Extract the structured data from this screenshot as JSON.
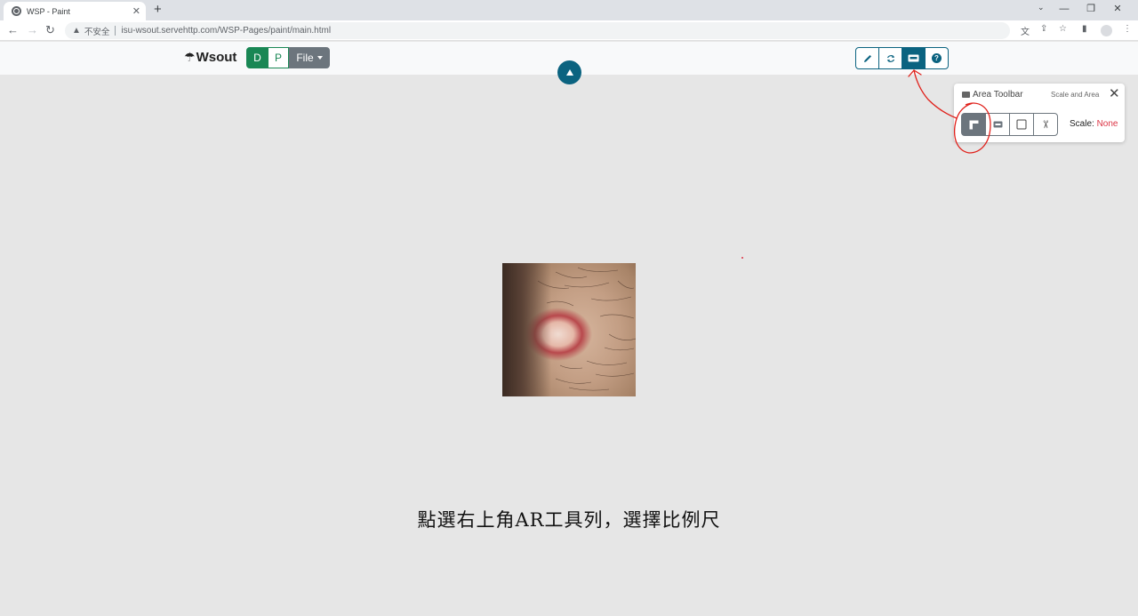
{
  "browser": {
    "tab_title": "WSP - Paint",
    "tab_close": "✕",
    "new_tab": "+",
    "security_label": "不安全",
    "url": "isu-wsout.servehttp.com/WSP-Pages/paint/main.html"
  },
  "navbar": {
    "brand_icon": "☂",
    "brand": "Wsout",
    "btn_d": "D",
    "btn_p": "P",
    "btn_file": "File",
    "tools": [
      "pencil-icon",
      "refresh-icon",
      "ar-icon",
      "help-icon"
    ],
    "help_glyph": "?"
  },
  "area_toolbar": {
    "title": "Area Toolbar",
    "subtitle": "Scale and Area",
    "close": "✕",
    "buttons": [
      "ruler-icon",
      "ar-icon",
      "square-icon",
      "scissors-icon"
    ],
    "scale_label": "Scale:",
    "scale_value": "None",
    "scissors_glyph": "✂"
  },
  "canvas": {
    "caption": "點選右上角AR工具列，選擇比例尺"
  },
  "colors": {
    "primary": "#0b6380",
    "success": "#198754",
    "secondary": "#6c757d",
    "danger": "#dc3545",
    "annotation": "#e0201a"
  }
}
